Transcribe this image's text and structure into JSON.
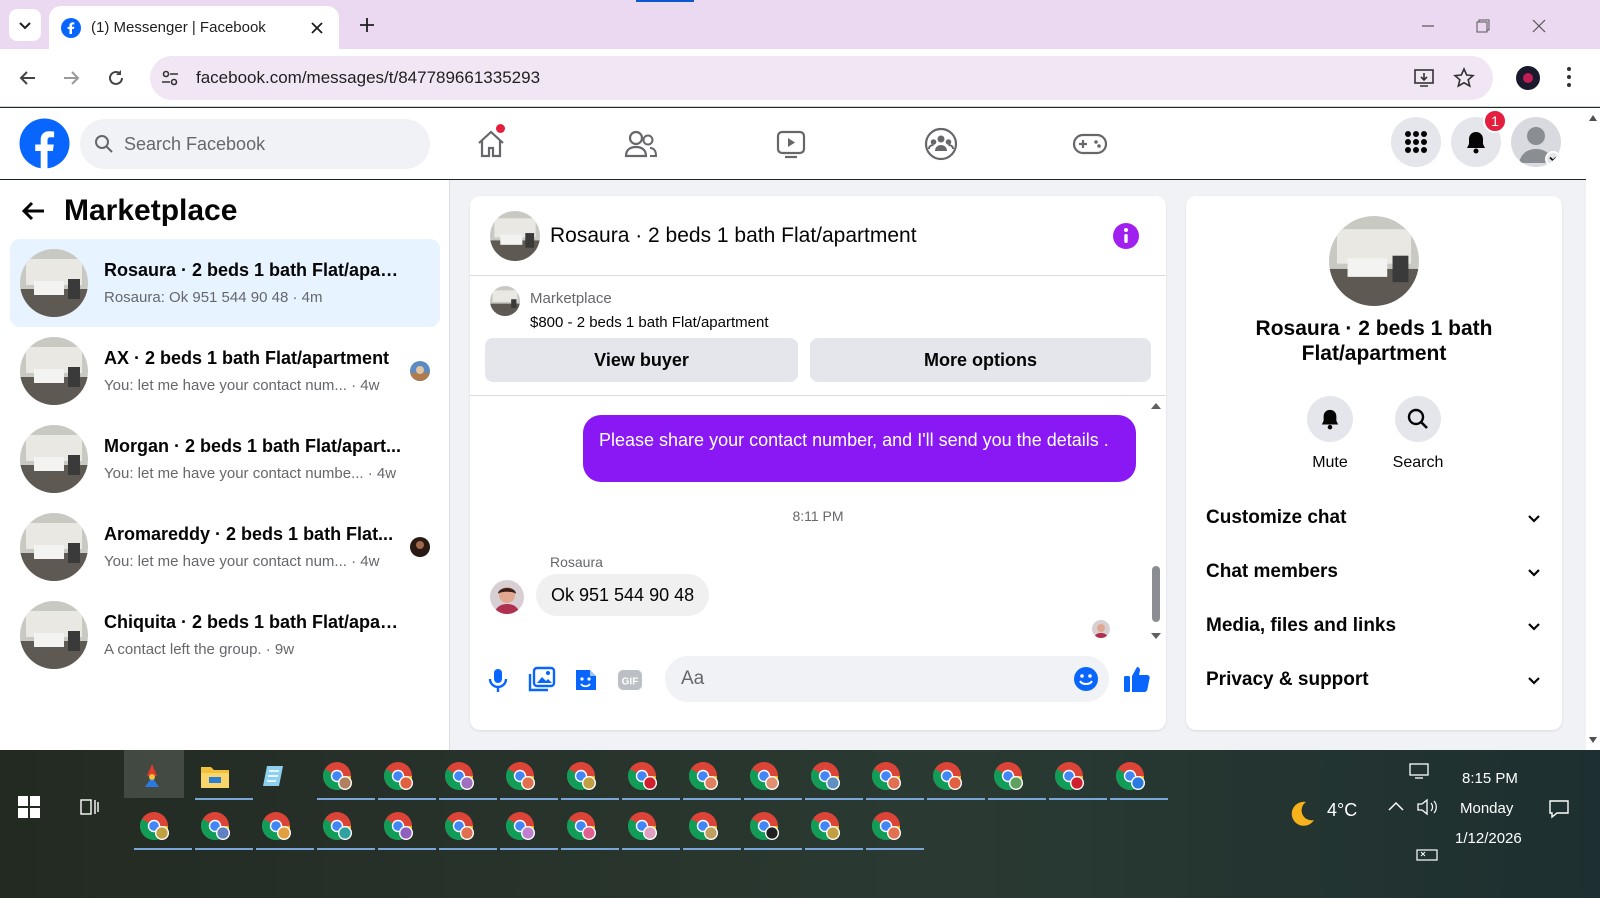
{
  "browser": {
    "tab_title": "(1) Messenger | Facebook",
    "url": "facebook.com/messages/t/847789661335293"
  },
  "fb": {
    "search_placeholder": "Search Facebook",
    "notifications_count": "1"
  },
  "left": {
    "title": "Marketplace",
    "conversations": [
      {
        "name": "Rosaura · 2 beds 1 bath Flat/apart...",
        "snippet": "Rosaura: Ok 951 544 90 48 · 4m",
        "active": true
      },
      {
        "name": "AX · 2 beds 1 bath Flat/apartment",
        "snippet": "You: let me have your contact num... · 4w"
      },
      {
        "name": "Morgan · 2 beds 1 bath Flat/apart...",
        "snippet": "You: let me have your contact numbe... · 4w"
      },
      {
        "name": "Aromareddy · 2 beds 1 bath Flat...",
        "snippet": "You: let me have your contact num... · 4w"
      },
      {
        "name": "Chiquita · 2 beds 1 bath Flat/apart...",
        "snippet": "A contact left the group. · 9w"
      }
    ]
  },
  "chat": {
    "title": "Rosaura · 2 beds 1 bath Flat/apartment",
    "marketplace_label": "Marketplace",
    "listing": "$800 - 2 beds 1 bath Flat/apartment",
    "view_buyer": "View buyer",
    "more_options": "More options",
    "outgoing_message": "Please share your contact number, and I'll send you the details .",
    "time": "8:11 PM",
    "sender": "Rosaura",
    "incoming_message": "Ok 951 544 90 48",
    "input_placeholder": "Aa"
  },
  "right": {
    "name": "Rosaura · 2 beds 1 bath Flat/apartment",
    "mute": "Mute",
    "search": "Search",
    "sections": [
      "Customize chat",
      "Chat members",
      "Media, files and links",
      "Privacy & support"
    ]
  },
  "taskbar": {
    "weather": "4°C",
    "time": "8:15 PM",
    "day": "Monday",
    "date": "1/12/2026"
  },
  "colors": {
    "fb_blue": "#0866ff",
    "messenger_purple": "#8a18f5",
    "active_row": "#e7f3ff"
  }
}
